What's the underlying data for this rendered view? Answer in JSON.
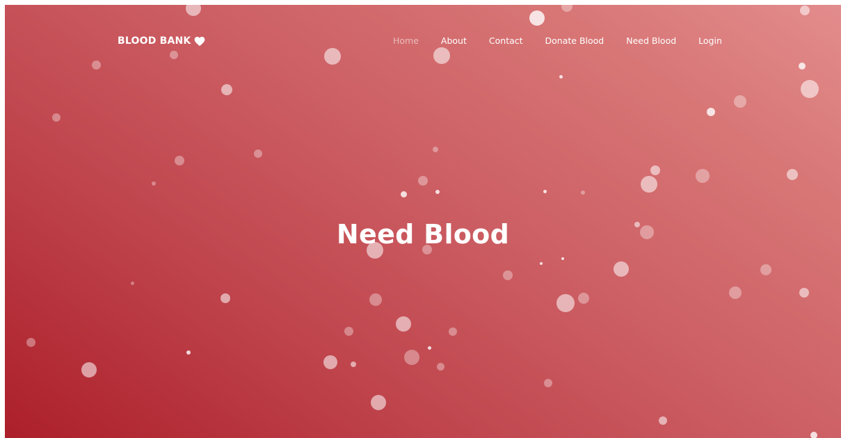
{
  "brand": {
    "name": "BLOOD BANK",
    "icon": "heart-icon"
  },
  "nav": {
    "items": [
      {
        "label": "Home",
        "active": true
      },
      {
        "label": "About",
        "active": false
      },
      {
        "label": "Contact",
        "active": false
      },
      {
        "label": "Donate Blood",
        "active": false
      },
      {
        "label": "Need Blood",
        "active": false
      },
      {
        "label": "Login",
        "active": false
      }
    ]
  },
  "hero": {
    "title": "Need Blood"
  },
  "colors": {
    "gradient_dark": "#ac1f2a",
    "gradient_mid": "#cc5f64",
    "gradient_light": "#e38c8d",
    "text": "#ffffff"
  }
}
